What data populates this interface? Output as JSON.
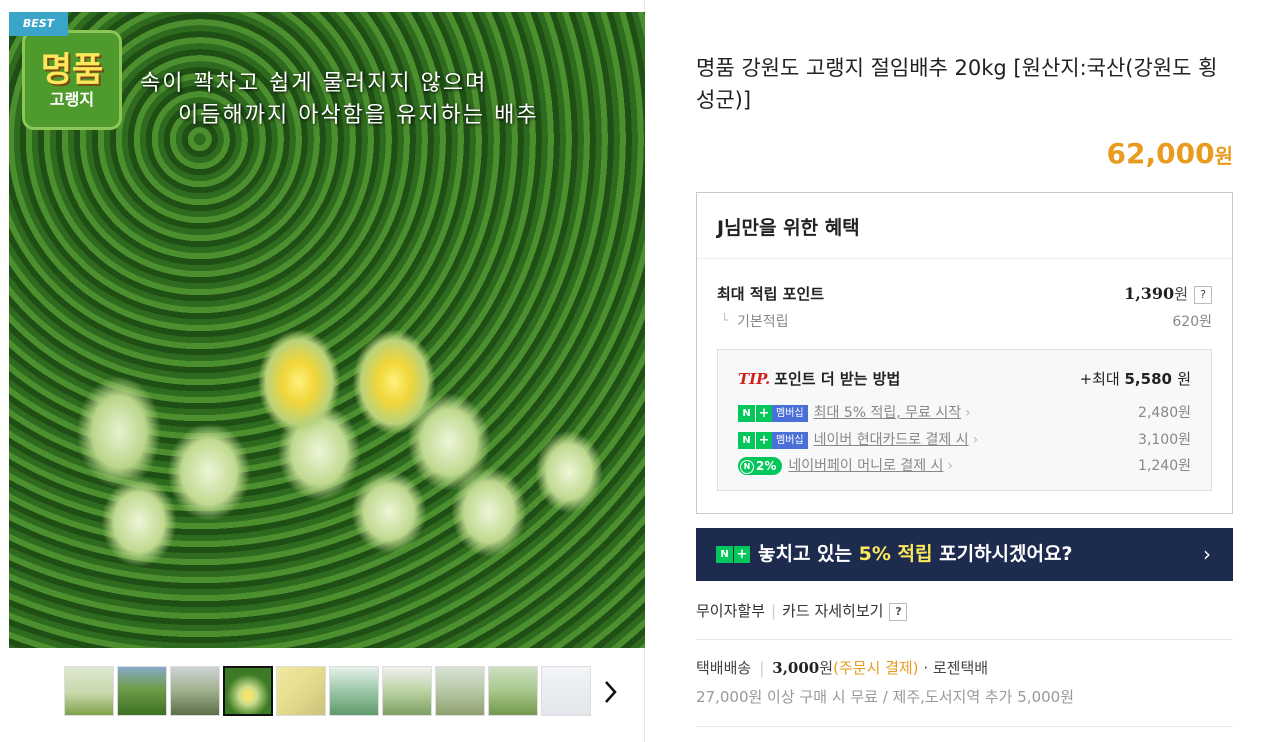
{
  "gallery": {
    "badge": "BEST",
    "logo_big": "명품",
    "logo_small": "고랭지",
    "slogan_line1": "속이 꽉차고 쉽게 물러지지 않으며",
    "slogan_line2": "이듬해까지 아삭함을 유지하는 배추",
    "thumbnails": 10,
    "active_thumbnail": 4,
    "next_icon": "chevron-right-icon"
  },
  "product": {
    "title": "명품 강원도 고랭지 절임배추 20kg [원산지:국산(강원도 횡성군)]",
    "price": "62,000",
    "price_unit": "원"
  },
  "benefit": {
    "heading": "J님만을 위한 혜택",
    "max_points_label": "최대 적립 포인트",
    "max_points_value": "1,390",
    "max_points_unit": "원",
    "help": "?",
    "basic_label": "기본적립",
    "basic_value": "620원",
    "tip_mark": "TIP.",
    "tip_label": "포인트 더 받는 방법",
    "tip_value_prefix": "+최대 ",
    "tip_value": "5,580",
    "tip_unit": "원",
    "membership_tag": "멤버십",
    "tips": [
      {
        "label": "최대 5% 적립, 무료 시작",
        "value": "2,480원"
      },
      {
        "label": "네이버 현대카드로 결제 시",
        "value": "3,100원"
      },
      {
        "label": "네이버페이 머니로 결제 시",
        "value": "1,240원"
      }
    ],
    "pay_badge": "2%"
  },
  "promo": {
    "before": "놓치고 있는 ",
    "highlight": "5% 적립",
    "after": " 포기하시겠어요?",
    "arrow": "›"
  },
  "installment": {
    "label": "무이자할부",
    "card_link": "카드 자세히보기",
    "help": "?"
  },
  "shipping": {
    "method": "택배배송",
    "fee": "3,000",
    "fee_unit": "원",
    "fee_note": "(주문시 결제)",
    "courier": "· 로젠택배",
    "note": "27,000원 이상 구매 시 무료 / 제주,도서지역 추가 5,000원"
  },
  "colors": {
    "price": "#e89b1e",
    "promo_bg": "#1d2b4e",
    "promo_highlight": "#fde85c",
    "naver_green": "#03c75a",
    "tip_red": "#d0201e"
  }
}
